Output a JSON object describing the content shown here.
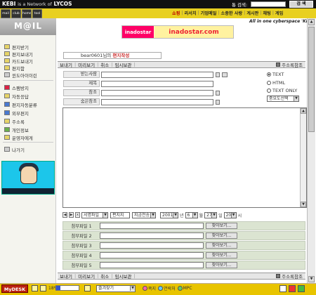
{
  "header": {
    "brand": {
      "part1": "KEBI",
      "part2": "is a Network of",
      "part3": "LYCOS"
    },
    "search": {
      "label": "통 검색:",
      "placeholder": "",
      "button": "검 색"
    },
    "app_icons": [
      "mail",
      "club",
      "home",
      "tool"
    ],
    "nav_links": [
      "쇼핑",
      "리서치",
      "기업메일",
      "소중한 사랑",
      "게시판",
      "채팅",
      "게임"
    ],
    "tagline": "All in one cyberspace 'KEBI'"
  },
  "sidebar": {
    "logo": "M@IL",
    "items": [
      {
        "label": "편지받기",
        "icon": "inbox-icon",
        "color": "yellow"
      },
      {
        "label": "편지보내기",
        "icon": "send-icon",
        "color": "yellow"
      },
      {
        "label": "카드보내기",
        "icon": "card-icon",
        "color": "yellow"
      },
      {
        "label": "편지함",
        "icon": "mailbox-icon",
        "color": "yellow"
      },
      {
        "label": "윈도아이이린",
        "icon": "window-icon",
        "color": "gray"
      },
      {
        "label": "스팸방지",
        "icon": "spam-icon",
        "color": "red"
      },
      {
        "label": "자동응답",
        "icon": "auto-reply-icon",
        "color": "yellow"
      },
      {
        "label": "편지자동분류",
        "icon": "filter-icon",
        "color": "blue"
      },
      {
        "label": "외부편지",
        "icon": "external-mail-icon",
        "color": "blue"
      },
      {
        "label": "주소록",
        "icon": "address-book-icon",
        "color": "yellow"
      },
      {
        "label": "개인정보",
        "icon": "profile-icon",
        "color": "green"
      },
      {
        "label": "운영자에게",
        "icon": "admin-icon",
        "color": "yellow"
      },
      {
        "label": "나가기",
        "icon": "logout-icon",
        "color": "gray"
      }
    ]
  },
  "banner": {
    "left": "inadostar",
    "right": "inadostar.com"
  },
  "compose": {
    "user": "bear0601님의",
    "title": "편지작성"
  },
  "toolbar": {
    "buttons": [
      "보내기",
      "미리보기",
      "취소",
      "임시보관"
    ],
    "addressbook": "주소록참조"
  },
  "form": {
    "to_label": "받는사람",
    "subject_label": "제목",
    "cc_label": "참조",
    "bcc_label": "숨은참조",
    "format_options": [
      "TEXT",
      "HTML",
      "TEXT ONLY"
    ],
    "format_selected": "TEXT",
    "importance": "중요도선택"
  },
  "send_options": {
    "signature": "서명파일",
    "template": "편지지",
    "send_mode": "지금전송",
    "year": "2001",
    "year_unit": "년",
    "month": "6",
    "month_unit": "월",
    "day": "27",
    "day_unit": "일",
    "hour": "20",
    "hour_unit": "시"
  },
  "attachments": {
    "labels": [
      "첨부파일 1",
      "첨부파일 2",
      "첨부파일 3",
      "첨부파일 4",
      "첨부파일 5"
    ],
    "browse_label": "찾아보기..."
  },
  "bottom": {
    "brand": "MyDESK",
    "progress": "18%",
    "progress_value": 0.18,
    "favorites": "즐겨찾기",
    "mini_items": [
      "쪽지",
      "연락처",
      "MPC"
    ]
  }
}
